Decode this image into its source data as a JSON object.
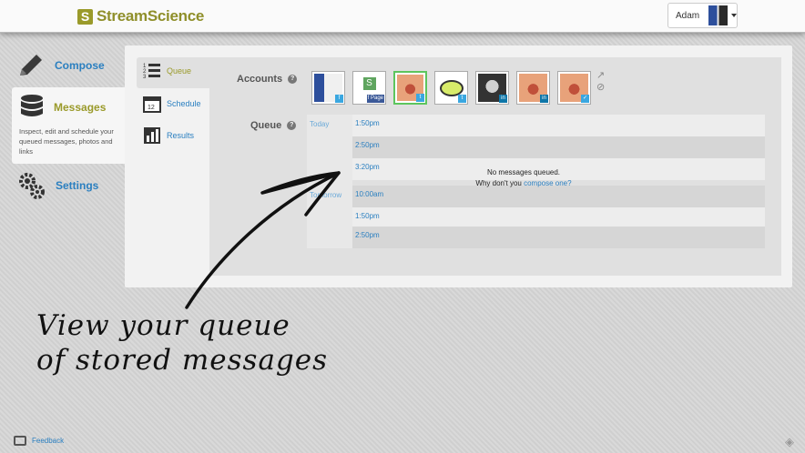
{
  "app": {
    "logo_mark": "S",
    "logo_text": "StreamScience",
    "user_name": "Adam"
  },
  "main_nav": {
    "compose": "Compose",
    "messages": "Messages",
    "messages_desc": "Inspect, edit and schedule your queued messages, photos and links",
    "settings": "Settings"
  },
  "sub_nav": {
    "queue": "Queue",
    "schedule": "Schedule",
    "results": "Results"
  },
  "accounts": {
    "label": "Accounts",
    "help": "?",
    "items": [
      {
        "badge": "f"
      },
      {
        "badge": "f Page"
      },
      {
        "badge": "t",
        "selected": true
      },
      {
        "badge": "t"
      },
      {
        "badge": "in"
      },
      {
        "badge": "in"
      },
      {
        "badge": "✓"
      }
    ],
    "tool_icons": [
      "external-link-icon",
      "ban-icon"
    ]
  },
  "queue": {
    "label": "Queue",
    "help": "?",
    "days": [
      "Today",
      "Tomorrow"
    ],
    "rows": [
      "1:50pm",
      "2:50pm",
      "3:20pm",
      "10:00am",
      "1:50pm",
      "2:50pm"
    ],
    "empty_line1": "No messages queued.",
    "empty_line2_prefix": "Why don't you ",
    "empty_link": "compose one?"
  },
  "annotation": {
    "line1": "View your queue",
    "line2": "of stored messages"
  },
  "footer": {
    "feedback": "Feedback"
  },
  "colors": {
    "accent_blue": "#2a7fc0",
    "brand_olive": "#9a9a2a",
    "selected_green": "#5dc55d"
  }
}
